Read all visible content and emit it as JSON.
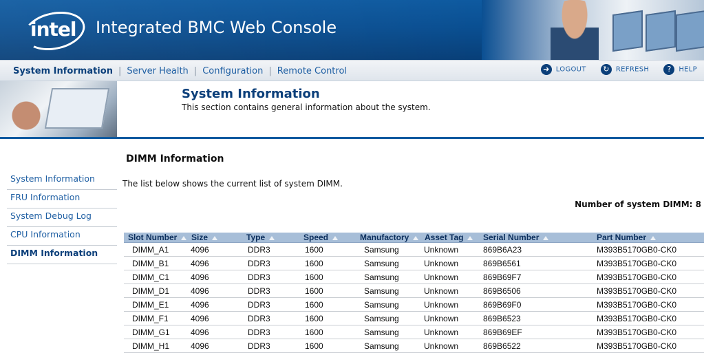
{
  "header": {
    "logo_text": "intel",
    "title": "Integrated BMC Web Console"
  },
  "nav": {
    "items": [
      {
        "label": "System Information",
        "active": true
      },
      {
        "label": "Server Health",
        "active": false
      },
      {
        "label": "Configuration",
        "active": false
      },
      {
        "label": "Remote Control",
        "active": false
      }
    ],
    "actions": {
      "logout": "LOGOUT",
      "refresh": "REFRESH",
      "help": "HELP"
    }
  },
  "section": {
    "title": "System Information",
    "description": "This section contains general information about the system."
  },
  "sidebar": {
    "items": [
      {
        "label": "System Information",
        "active": false
      },
      {
        "label": "FRU Information",
        "active": false
      },
      {
        "label": "System Debug Log",
        "active": false
      },
      {
        "label": "CPU Information",
        "active": false
      },
      {
        "label": "DIMM Information",
        "active": true
      }
    ]
  },
  "content": {
    "title": "DIMM Information",
    "description": "The list below shows the current list of system DIMM.",
    "count_label": "Number of system DIMM: 8"
  },
  "table": {
    "columns": [
      "Slot Number",
      "Size",
      "Type",
      "Speed",
      "Manufactory",
      "Asset Tag",
      "Serial Number",
      "Part Number"
    ],
    "rows": [
      [
        "DIMM_A1",
        "4096",
        "DDR3",
        "1600",
        "Samsung",
        "Unknown",
        "869B6A23",
        "M393B5170GB0-CK0"
      ],
      [
        "DIMM_B1",
        "4096",
        "DDR3",
        "1600",
        "Samsung",
        "Unknown",
        "869B6561",
        "M393B5170GB0-CK0"
      ],
      [
        "DIMM_C1",
        "4096",
        "DDR3",
        "1600",
        "Samsung",
        "Unknown",
        "869B69F7",
        "M393B5170GB0-CK0"
      ],
      [
        "DIMM_D1",
        "4096",
        "DDR3",
        "1600",
        "Samsung",
        "Unknown",
        "869B6506",
        "M393B5170GB0-CK0"
      ],
      [
        "DIMM_E1",
        "4096",
        "DDR3",
        "1600",
        "Samsung",
        "Unknown",
        "869B69F0",
        "M393B5170GB0-CK0"
      ],
      [
        "DIMM_F1",
        "4096",
        "DDR3",
        "1600",
        "Samsung",
        "Unknown",
        "869B6523",
        "M393B5170GB0-CK0"
      ],
      [
        "DIMM_G1",
        "4096",
        "DDR3",
        "1600",
        "Samsung",
        "Unknown",
        "869B69EF",
        "M393B5170GB0-CK0"
      ],
      [
        "DIMM_H1",
        "4096",
        "DDR3",
        "1600",
        "Samsung",
        "Unknown",
        "869B6522",
        "M393B5170GB0-CK0"
      ]
    ]
  },
  "colors": {
    "brand_blue": "#0e5aa0",
    "link_blue": "#1f5fa3",
    "table_header": "#a7bed8"
  }
}
